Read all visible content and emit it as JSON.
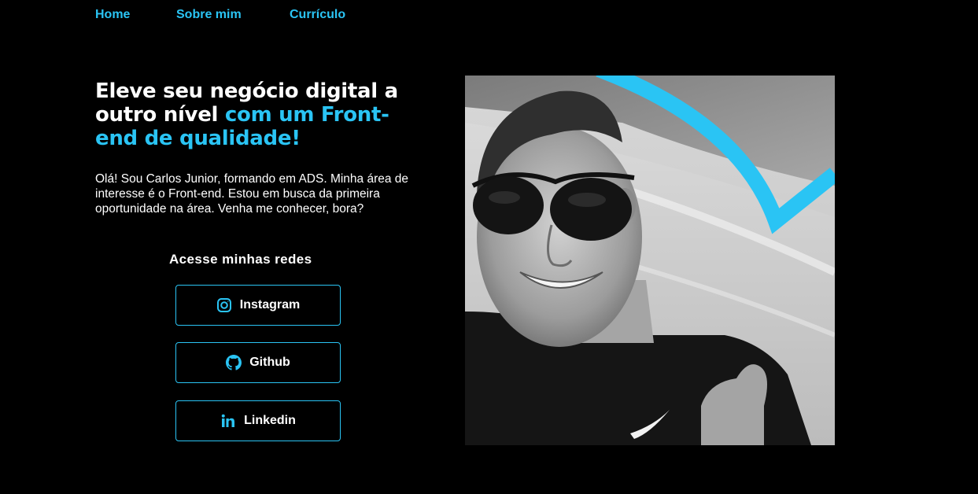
{
  "nav": {
    "items": [
      {
        "label": "Home"
      },
      {
        "label": "Sobre mim"
      },
      {
        "label": "Currículo"
      }
    ]
  },
  "hero": {
    "headline_part1": "Eleve seu negócio digital a outro nível ",
    "headline_highlight": "com um Front-end de qualidade!",
    "intro": "Olá! Sou Carlos Junior, formando em ADS. Minha área de interesse é o Front-end. Estou em busca da primeira oportunidade na área. Venha me conhecer, bora?"
  },
  "social": {
    "title": "Acesse minhas redes",
    "links": [
      {
        "label": "Instagram",
        "icon": "instagram-icon"
      },
      {
        "label": "Github",
        "icon": "github-icon"
      },
      {
        "label": "Linkedin",
        "icon": "linkedin-icon"
      }
    ]
  },
  "colors": {
    "accent": "#2ac4f4",
    "background": "#000000",
    "text": "#ffffff"
  }
}
